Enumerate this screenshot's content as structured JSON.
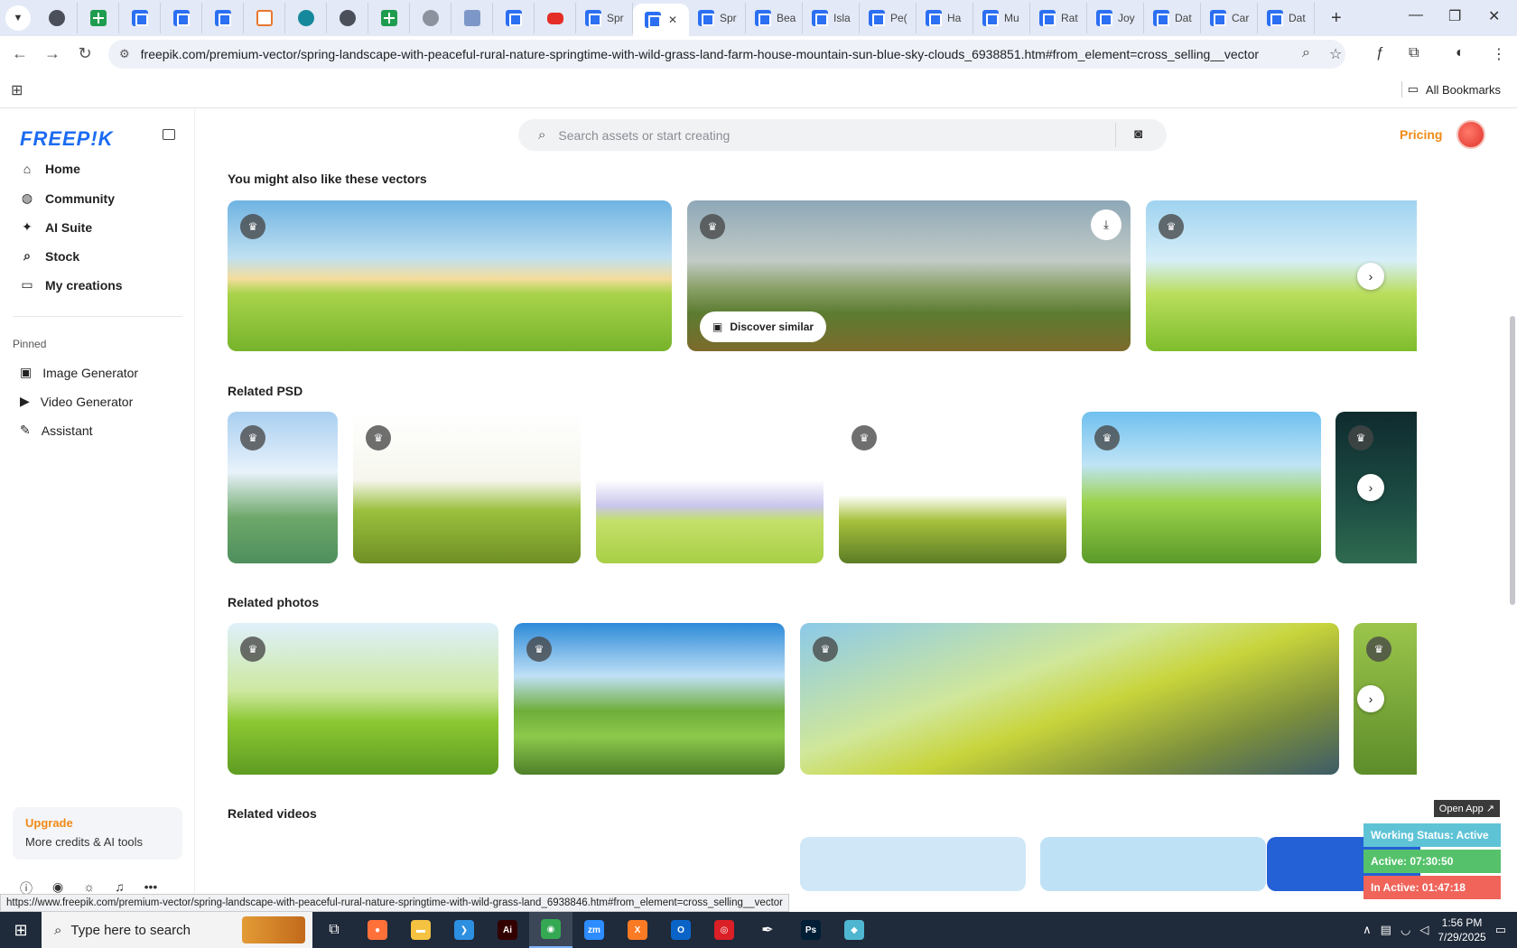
{
  "browser": {
    "tabs": [
      {
        "kind": "round",
        "label": ""
      },
      {
        "kind": "sheet",
        "label": ""
      },
      {
        "kind": "doc",
        "label": ""
      },
      {
        "kind": "doc",
        "label": ""
      },
      {
        "kind": "doc",
        "label": ""
      },
      {
        "kind": "orange",
        "label": ""
      },
      {
        "kind": "teal",
        "label": ""
      },
      {
        "kind": "round",
        "label": ""
      },
      {
        "kind": "sheet",
        "label": ""
      },
      {
        "kind": "grey",
        "label": ""
      },
      {
        "kind": "grid",
        "label": ""
      },
      {
        "kind": "doc",
        "label": ""
      },
      {
        "kind": "yt",
        "label": ""
      },
      {
        "kind": "doc",
        "label": "Spr"
      },
      {
        "kind": "doc",
        "label": "",
        "active": true
      },
      {
        "kind": "doc",
        "label": "Spr"
      },
      {
        "kind": "doc",
        "label": "Bea"
      },
      {
        "kind": "doc",
        "label": "Isla"
      },
      {
        "kind": "doc",
        "label": "Pe("
      },
      {
        "kind": "doc",
        "label": "Ha"
      },
      {
        "kind": "doc",
        "label": "Mu"
      },
      {
        "kind": "doc",
        "label": "Rat"
      },
      {
        "kind": "doc",
        "label": "Joy"
      },
      {
        "kind": "doc",
        "label": "Dat"
      },
      {
        "kind": "doc",
        "label": "Car"
      },
      {
        "kind": "doc",
        "label": "Dat"
      }
    ],
    "url": "freepik.com/premium-vector/spring-landscape-with-peaceful-rural-nature-springtime-with-wild-grass-land-farm-house-mountain-sun-blue-sky-clouds_6938851.htm#from_element=cross_selling__vector",
    "bookmarks_label": "All Bookmarks",
    "status_url": "https://www.freepik.com/premium-vector/spring-landscape-with-peaceful-rural-nature-springtime-with-wild-grass-land_6938846.htm#from_element=cross_selling__vector"
  },
  "sidebar": {
    "logo": "FREEP!K",
    "nav": [
      {
        "label": "Home",
        "icon": "home-icon",
        "glyph": "⌂"
      },
      {
        "label": "Community",
        "icon": "globe-icon",
        "glyph": "◍"
      },
      {
        "label": "AI Suite",
        "icon": "sparkle-icon",
        "glyph": "✦"
      },
      {
        "label": "Stock",
        "icon": "search-icon",
        "glyph": "⌕"
      },
      {
        "label": "My creations",
        "icon": "folder-icon",
        "glyph": "▭"
      }
    ],
    "pinned_label": "Pinned",
    "pinned": [
      {
        "label": "Image Generator",
        "icon": "image-icon",
        "glyph": "▣"
      },
      {
        "label": "Video Generator",
        "icon": "video-icon",
        "glyph": "▶"
      },
      {
        "label": "Assistant",
        "icon": "chat-icon",
        "glyph": "✎"
      }
    ],
    "upgrade": {
      "title": "Upgrade",
      "subtitle": "More credits & AI tools"
    }
  },
  "header": {
    "search_placeholder": "Search assets or start creating",
    "pricing": "Pricing"
  },
  "sections": {
    "vectors": {
      "title": "You might also like these vectors",
      "discover": "Discover similar"
    },
    "psd": {
      "title": "Related PSD"
    },
    "photos": {
      "title": "Related photos"
    },
    "videos": {
      "title": "Related videos"
    }
  },
  "widget": {
    "open_app": "Open App ↗",
    "working_status": "Working Status: Active",
    "active": "Active: 07:30:50",
    "inactive": "In Active: 01:47:18",
    "colors": {
      "status": "#5fc3d6",
      "active": "#55c26b",
      "inactive": "#f0645a"
    }
  },
  "taskbar": {
    "search_placeholder": "Type here to search",
    "time": "1:56 PM",
    "date": "7/29/2025",
    "apps": [
      {
        "name": "task-view-icon",
        "glyph": "⧉",
        "color": ""
      },
      {
        "name": "firefox-icon",
        "glyph": "●",
        "color": "#ff7139"
      },
      {
        "name": "file-explorer-icon",
        "glyph": "▬",
        "color": "#f5c242"
      },
      {
        "name": "vscode-icon",
        "glyph": "❯",
        "color": "#2d8fe0"
      },
      {
        "name": "illustrator-icon",
        "glyph": "Ai",
        "color": "#330000"
      },
      {
        "name": "chrome-icon",
        "glyph": "◉",
        "color": "#34a853",
        "active": true
      },
      {
        "name": "zoom-icon",
        "glyph": "zm",
        "color": "#2d8cff"
      },
      {
        "name": "xampp-icon",
        "glyph": "X",
        "color": "#fb7a24"
      },
      {
        "name": "outlook-icon",
        "glyph": "O",
        "color": "#0a64c8"
      },
      {
        "name": "creative-cloud-icon",
        "glyph": "◎",
        "color": "#da1f26"
      },
      {
        "name": "pen-tool-icon",
        "glyph": "✒",
        "color": ""
      },
      {
        "name": "photoshop-icon",
        "glyph": "Ps",
        "color": "#001e36"
      },
      {
        "name": "app-icon",
        "glyph": "◆",
        "color": "#4fb6d1"
      }
    ]
  }
}
